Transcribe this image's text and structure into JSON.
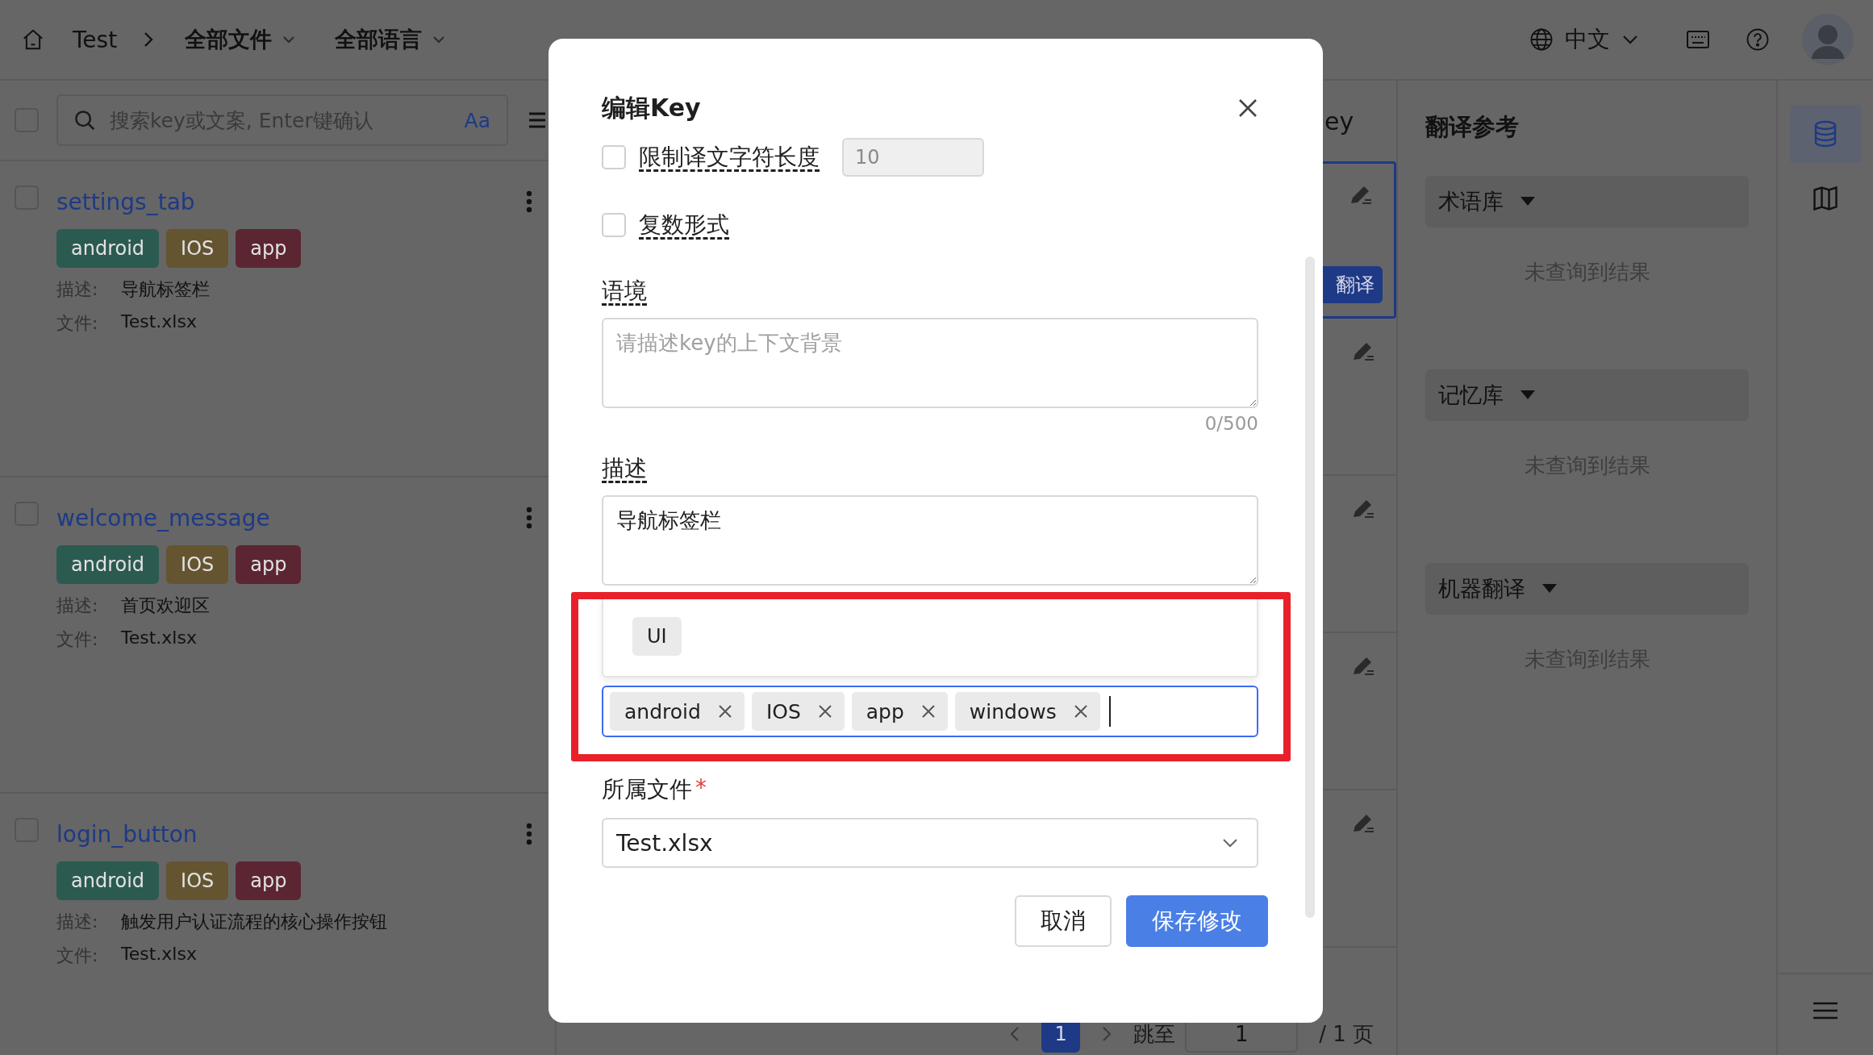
{
  "top_bar": {
    "breadcrumb": "Test",
    "file_filter": "全部文件",
    "language_filter": "全部语言",
    "ui_language": "中文"
  },
  "key_list": {
    "select_all": {
      "checked": false
    },
    "search": {
      "placeholder": "搜索key或文案, Enter键确认",
      "case_toggle": "Aa"
    },
    "items": [
      {
        "key": "settings_tab",
        "checked": false,
        "tags": [
          {
            "label": "android",
            "color": "#2b5a51"
          },
          {
            "label": "IOS",
            "color": "#645530"
          },
          {
            "label": "app",
            "color": "#5b2532"
          }
        ],
        "description_label": "描述:",
        "description": "导航标签栏",
        "file_label": "文件:",
        "file": "Test.xlsx"
      },
      {
        "key": "welcome_message",
        "checked": false,
        "tags": [
          {
            "label": "android",
            "color": "#2b5a51"
          },
          {
            "label": "IOS",
            "color": "#645530"
          },
          {
            "label": "app",
            "color": "#5b2532"
          }
        ],
        "description_label": "描述:",
        "description": "首页欢迎区",
        "file_label": "文件:",
        "file": "Test.xlsx"
      },
      {
        "key": "login_button",
        "checked": false,
        "tags": [
          {
            "label": "android",
            "color": "#2b5a51"
          },
          {
            "label": "IOS",
            "color": "#645530"
          },
          {
            "label": "app",
            "color": "#5b2532"
          }
        ],
        "description_label": "描述:",
        "description": "触发用户认证流程的核心操作按钮",
        "file_label": "文件:",
        "file": "Test.xlsx"
      }
    ]
  },
  "translation_column": {
    "header": "ey",
    "rows": [
      {
        "selected": true,
        "button": "翻译"
      },
      {
        "selected": false
      },
      {
        "selected": false
      },
      {
        "selected": false
      },
      {
        "selected": false
      }
    ]
  },
  "pagination": {
    "pages": [
      {
        "label": "1",
        "selected": true
      }
    ],
    "jump_label": "跳至",
    "jump_value": "1",
    "total": "/ 1 页"
  },
  "reference_panel": {
    "title": "翻译参考",
    "sections": [
      {
        "title": "术语库",
        "empty_text": "未查询到结果"
      },
      {
        "title": "记忆库",
        "empty_text": "未查询到结果"
      },
      {
        "title": "机器翻译",
        "empty_text": "未查询到结果"
      }
    ]
  },
  "side_rail": {
    "items": [
      {
        "kind": "database",
        "selected": true
      },
      {
        "kind": "map",
        "selected": false
      }
    ]
  },
  "dialog": {
    "title": "编辑Key",
    "length_limit": {
      "label": "限制译文字符长度",
      "checked": false,
      "value": "10",
      "disabled": true
    },
    "plural": {
      "label": "复数形式",
      "checked": false
    },
    "context": {
      "label": "语境",
      "placeholder": "请描述key的上下文背景",
      "counter": "0/500"
    },
    "description": {
      "label": "描述",
      "value": "导航标签栏"
    },
    "tag_suggestions": [
      {
        "label": "UI"
      }
    ],
    "tags": [
      {
        "label": "android"
      },
      {
        "label": "IOS"
      },
      {
        "label": "app"
      },
      {
        "label": "windows"
      }
    ],
    "file": {
      "label": "所属文件",
      "required_mark": "*",
      "value": "Test.xlsx"
    },
    "buttons": [
      {
        "kind": "secondary",
        "label": "取消"
      },
      {
        "kind": "primary",
        "label": "保存修改"
      }
    ]
  }
}
